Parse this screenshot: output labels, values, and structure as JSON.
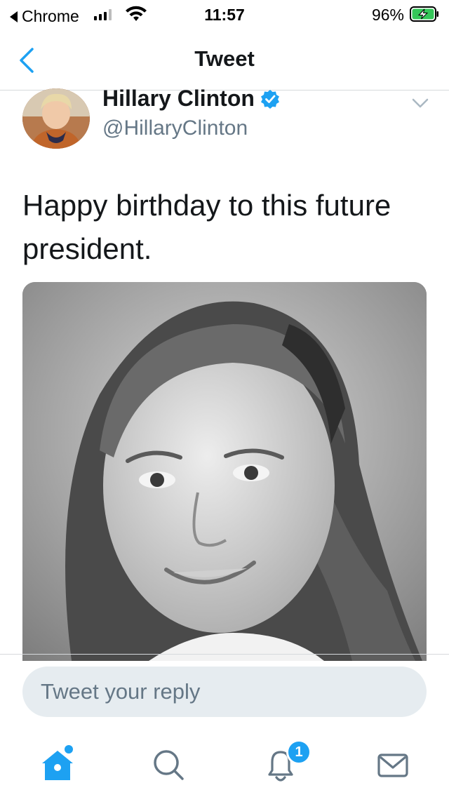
{
  "status_bar": {
    "back_app": "Chrome",
    "time": "11:57",
    "battery_percent": "96%",
    "battery_level": 0.96,
    "charging": true
  },
  "nav": {
    "title": "Tweet",
    "back_icon": "chevron-left-icon"
  },
  "tweet": {
    "author_name": "Hillary Clinton",
    "author_handle": "@HillaryClinton",
    "verified": true,
    "text": "Happy birthday to this future president."
  },
  "reply": {
    "placeholder": "Tweet your reply"
  },
  "tabbar": {
    "tabs": [
      {
        "name": "home",
        "icon": "home-icon",
        "active": true
      },
      {
        "name": "search",
        "icon": "search-icon",
        "active": false
      },
      {
        "name": "notifications",
        "icon": "bell-icon",
        "active": false,
        "badge": "1"
      },
      {
        "name": "messages",
        "icon": "mail-icon",
        "active": false
      }
    ]
  },
  "colors": {
    "accent": "#1da1f2",
    "text_primary": "#14171a",
    "text_secondary": "#657786",
    "reply_bg": "#e6ecf0",
    "battery_green": "#34c759"
  }
}
